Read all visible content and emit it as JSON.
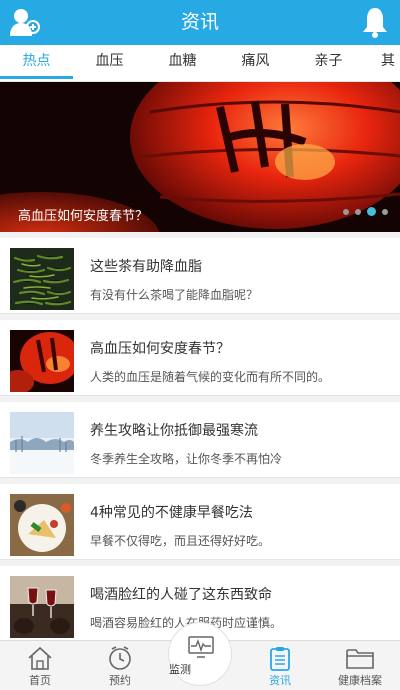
{
  "header": {
    "title": "资讯",
    "left_icon": "user-icon",
    "right_icon": "bell-icon"
  },
  "tabs": [
    {
      "label": "热点",
      "active": true
    },
    {
      "label": "血压"
    },
    {
      "label": "血糖"
    },
    {
      "label": "痛风"
    },
    {
      "label": "亲子"
    },
    {
      "label": "其"
    }
  ],
  "banner": {
    "caption": "高血压如何安度春节？",
    "slide_count": 4,
    "active_slide": 3
  },
  "articles": [
    {
      "title": "这些茶有助降血脂",
      "summary": "有没有什么茶喝了能降血脂呢？",
      "thumb": "green-tea"
    },
    {
      "title": "高血压如何安度春节？",
      "summary": "人类的血压是随着气候的变化而有所不同的。",
      "thumb": "red-lantern"
    },
    {
      "title": "养生攻略让你抵御最强寒流",
      "summary": "冬季养生全攻略，让你冬季不再怕冷",
      "thumb": "snow-landscape"
    },
    {
      "title": "4种常见的不健康早餐吃法",
      "summary": "早餐不仅得吃，而且还得好好吃。",
      "thumb": "breakfast"
    },
    {
      "title": "喝酒脸红的人碰了这东西致命",
      "summary": "喝酒容易脸红的人在服药时应谨慎。",
      "thumb": "wine-toast"
    }
  ],
  "bottom_nav": [
    {
      "label": "首页",
      "icon": "home-icon"
    },
    {
      "label": "预约",
      "icon": "clock-icon"
    },
    {
      "label": "监测",
      "icon": "monitor-icon"
    },
    {
      "label": "资讯",
      "icon": "clipboard-icon",
      "active": true
    },
    {
      "label": "健康档案",
      "icon": "folder-icon"
    }
  ],
  "colors": {
    "accent": "#27a9e3",
    "active_dot": "#45c0d6"
  }
}
